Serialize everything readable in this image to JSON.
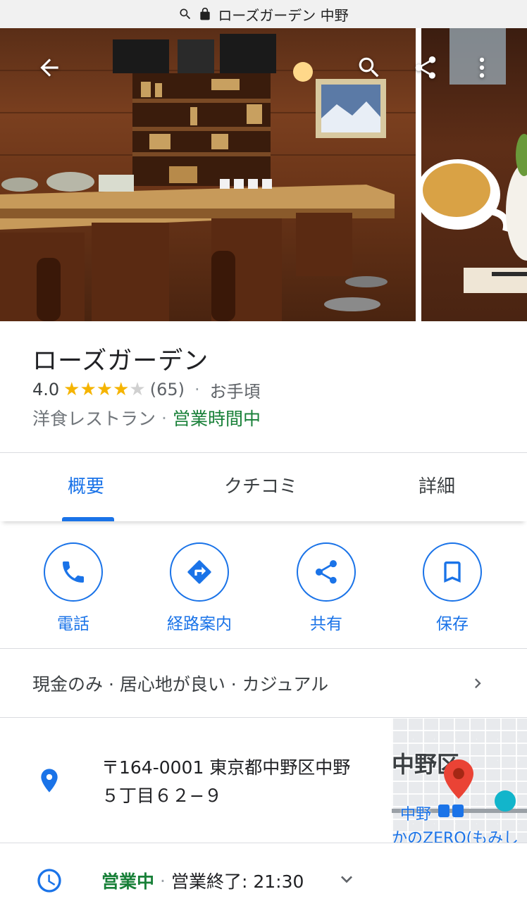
{
  "browser": {
    "url_text": "ローズガーデン 中野"
  },
  "place": {
    "name": "ローズガーデン",
    "rating": "4.0",
    "stars_filled": 4,
    "review_count": "(65)",
    "price": "お手頃",
    "category": "洋食レストラン",
    "open_status": "営業時間中"
  },
  "tabs": [
    {
      "label": "概要",
      "active": true
    },
    {
      "label": "クチコミ",
      "active": false
    },
    {
      "label": "詳細",
      "active": false
    }
  ],
  "actions": [
    {
      "label": "電話",
      "icon": "phone-icon"
    },
    {
      "label": "経路案内",
      "icon": "directions-icon"
    },
    {
      "label": "共有",
      "icon": "share-icon"
    },
    {
      "label": "保存",
      "icon": "bookmark-icon"
    }
  ],
  "attributes": {
    "text": "現金のみ · 居心地が良い · カジュアル"
  },
  "address": {
    "line1": "〒164-0001 東京都中野区中野",
    "line2": "５丁目６２−９"
  },
  "map": {
    "area_label": "中野区",
    "station_label": "中野",
    "poi_label": "かのZERO(もみし"
  },
  "hours": {
    "status": "営業中",
    "separator": "·",
    "closing": "営業終了: 21:30"
  },
  "colors": {
    "accent": "#1a73e8",
    "open_green": "#188038",
    "star": "#f5b400"
  }
}
